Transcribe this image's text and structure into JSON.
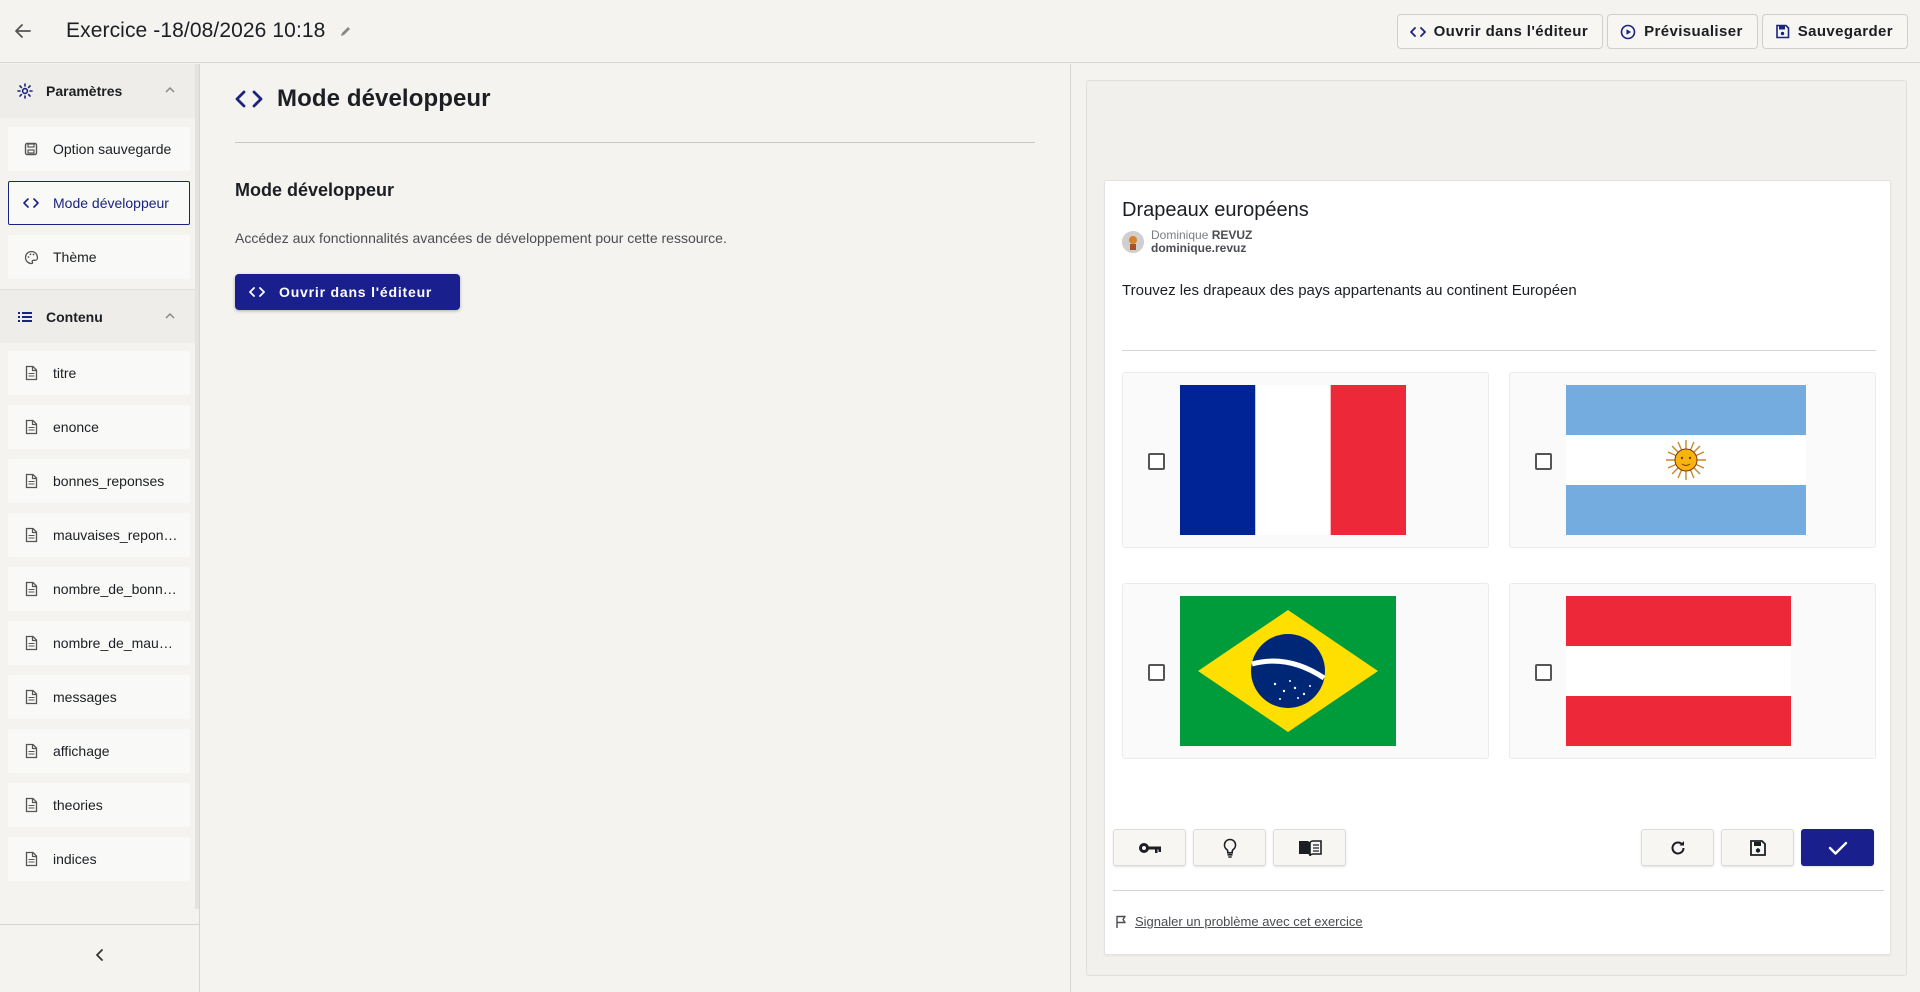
{
  "header": {
    "title": "Exercice -18/08/2026 10:18",
    "actions": {
      "open_editor": "Ouvrir dans l'éditeur",
      "preview": "Prévisualiser",
      "save": "Sauvegarder"
    }
  },
  "sidebar": {
    "sections": [
      {
        "label": "Paramètres",
        "items": [
          {
            "label": "Option sauvegarde",
            "icon": "save-icon"
          },
          {
            "label": "Mode développeur",
            "icon": "code-icon",
            "active": true
          },
          {
            "label": "Thème",
            "icon": "palette-icon"
          }
        ]
      },
      {
        "label": "Contenu",
        "items": [
          {
            "label": "titre",
            "icon": "file-icon"
          },
          {
            "label": "enonce",
            "icon": "file-icon"
          },
          {
            "label": "bonnes_reponses",
            "icon": "file-icon"
          },
          {
            "label": "mauvaises_reponses",
            "icon": "file-icon"
          },
          {
            "label": "nombre_de_bonnes_reponses",
            "icon": "file-icon"
          },
          {
            "label": "nombre_de_mauvaises_reponses",
            "icon": "file-icon"
          },
          {
            "label": "messages",
            "icon": "file-icon"
          },
          {
            "label": "affichage",
            "icon": "file-icon"
          },
          {
            "label": "theories",
            "icon": "file-icon"
          },
          {
            "label": "indices",
            "icon": "file-icon"
          }
        ]
      }
    ]
  },
  "main": {
    "heading": "Mode développeur",
    "subheading": "Mode développeur",
    "description": "Accédez aux fonctionnalités avancées de développement pour cette ressource.",
    "button_label": "Ouvrir dans l'éditeur"
  },
  "preview": {
    "title": "Drapeaux européens",
    "author": {
      "first": "Dominique",
      "last": "REVUZ",
      "username": "dominique.revuz"
    },
    "question": "Trouvez les drapeaux des pays appartenants au continent Européen",
    "options": [
      {
        "flag": "france",
        "checked": false
      },
      {
        "flag": "argentina",
        "checked": false
      },
      {
        "flag": "brazil",
        "checked": false
      },
      {
        "flag": "austria",
        "checked": false
      }
    ],
    "toolbar_icons": [
      "key-icon",
      "lightbulb-icon",
      "book-icon",
      "refresh-icon",
      "save-icon",
      "check-icon"
    ],
    "report_link": "Signaler un problème avec cet exercice"
  },
  "colors": {
    "primary": "#1a1f8e",
    "background": "#f4f3f0"
  }
}
